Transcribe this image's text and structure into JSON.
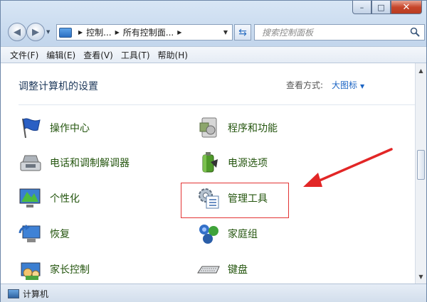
{
  "window": {
    "minimize_glyph": "–",
    "maximize_glyph": "□",
    "close_glyph": "✕"
  },
  "nav": {
    "back_glyph": "◀",
    "forward_glyph": "▶",
    "address": {
      "segments": [
        "控制...",
        "所有控制面..."
      ],
      "separator": "▶"
    },
    "search_placeholder": "搜索控制面板"
  },
  "menubar": {
    "items": [
      "文件(F)",
      "编辑(E)",
      "查看(V)",
      "工具(T)",
      "帮助(H)"
    ]
  },
  "content": {
    "title": "调整计算机的设置",
    "view_by_label": "查看方式:",
    "view_by_value": "大图标",
    "items": [
      {
        "label": "操作中心",
        "icon": "flag-icon"
      },
      {
        "label": "程序和功能",
        "icon": "programs-icon"
      },
      {
        "label": "电话和调制解调器",
        "icon": "phone-modem-icon"
      },
      {
        "label": "电源选项",
        "icon": "battery-icon"
      },
      {
        "label": "个性化",
        "icon": "personalize-icon"
      },
      {
        "label": "管理工具",
        "icon": "admin-tools-icon"
      },
      {
        "label": "恢复",
        "icon": "recovery-icon"
      },
      {
        "label": "家庭组",
        "icon": "homegroup-icon"
      },
      {
        "label": "家长控制",
        "icon": "parental-control-icon"
      },
      {
        "label": "键盘",
        "icon": "keyboard-icon"
      }
    ]
  },
  "statusbar": {
    "text": "计算机"
  },
  "colors": {
    "item_label": "#24550e",
    "title": "#1e395b",
    "link": "#1b64c4",
    "highlight": "#e33434"
  }
}
